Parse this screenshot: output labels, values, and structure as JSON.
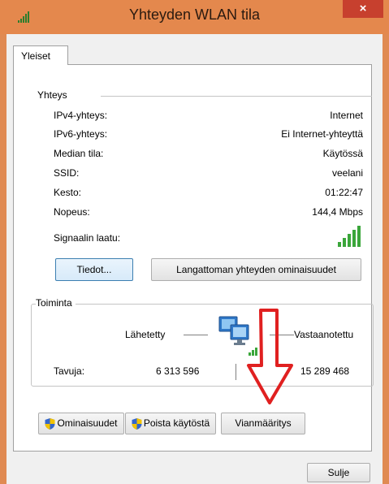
{
  "window": {
    "title": "Yhteyden WLAN tila",
    "close_glyph": "×",
    "icon": "wifi-signal-icon"
  },
  "tabs": [
    {
      "label": "Yleiset",
      "selected": true
    }
  ],
  "connection": {
    "title": "Yhteys",
    "rows": [
      {
        "label": "IPv4-yhteys:",
        "value": "Internet"
      },
      {
        "label": "IPv6-yhteys:",
        "value": "Ei Internet-yhteyttä"
      },
      {
        "label": "Median tila:",
        "value": "Käytössä"
      },
      {
        "label": "SSID:",
        "value": "veelani"
      },
      {
        "label": "Kesto:",
        "value": "01:22:47"
      },
      {
        "label": "Nopeus:",
        "value": "144,4 Mbps"
      }
    ],
    "signal_label": "Signaalin laatu:",
    "signal_bars": 5,
    "details_button": "Tiedot...",
    "wireless_props_button": "Langattoman yhteyden ominaisuudet"
  },
  "activity": {
    "title": "Toiminta",
    "sent_label": "Lähetetty",
    "received_label": "Vastaanotettu",
    "bytes_label": "Tavuja:",
    "sent_bytes": "6 313 596",
    "received_bytes": "15 289 468"
  },
  "actions": {
    "properties_button": "Ominaisuudet",
    "disable_button": "Poista käytöstä",
    "diagnose_button": "Vianmääritys"
  },
  "footer": {
    "close_button": "Sulje"
  },
  "colors": {
    "titlebar": "#e4884d",
    "close": "#c7402e",
    "signal": "#3aa63a",
    "annotation_arrow": "#e02020"
  }
}
